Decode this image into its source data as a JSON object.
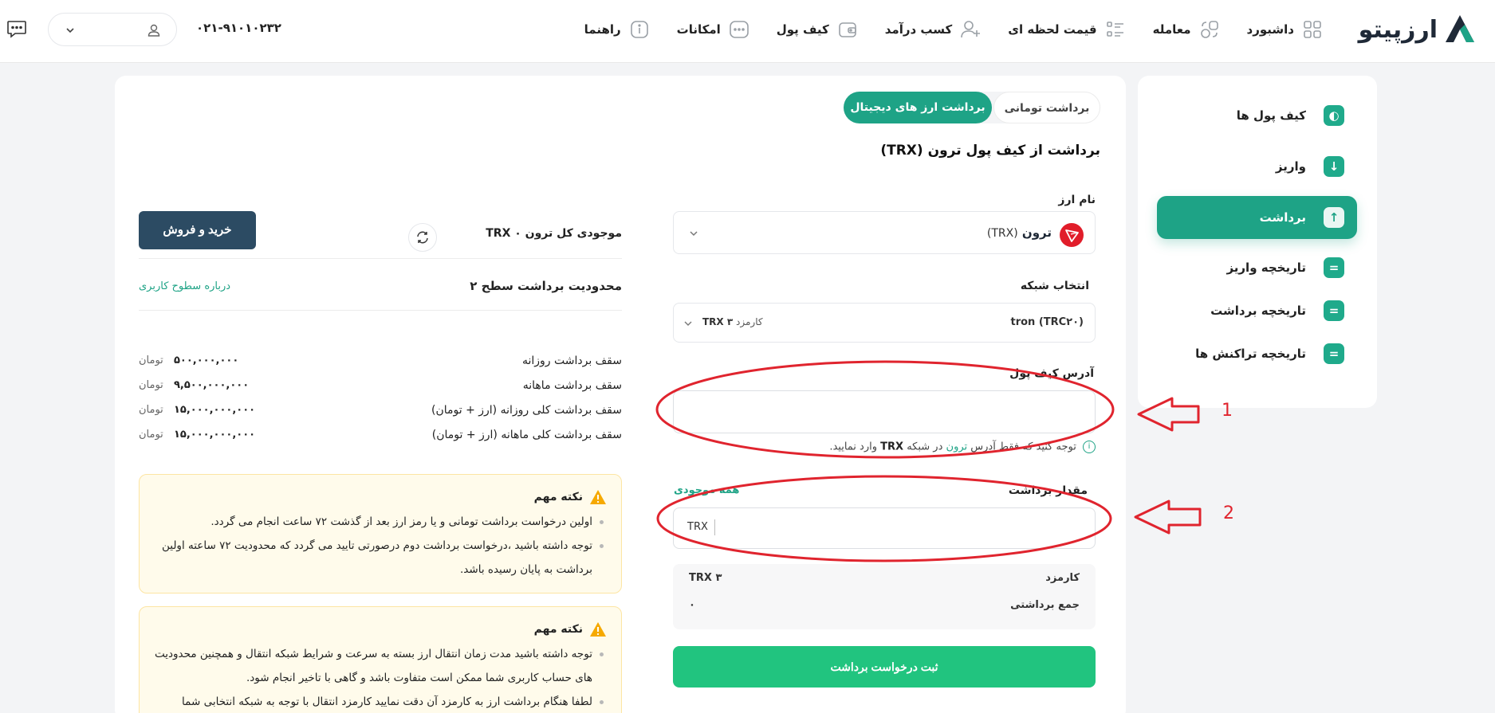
{
  "header": {
    "logo_text": "ارزپیتو",
    "nav": [
      {
        "label": "داشبورد",
        "icon": "grid-icon"
      },
      {
        "label": "معامله",
        "icon": "exchange-icon"
      },
      {
        "label": "قیمت لحظه ای",
        "icon": "price-list-icon"
      },
      {
        "label": "کسب درآمد",
        "icon": "user-plus-icon"
      },
      {
        "label": "کیف پول",
        "icon": "wallet-icon"
      },
      {
        "label": "امکانات",
        "icon": "dots-icon"
      },
      {
        "label": "راهنما",
        "icon": "info-icon"
      }
    ],
    "phone": "۰۲۱-۹۱۰۱۰۲۳۲"
  },
  "sidebar": {
    "items": [
      {
        "label": "کیف پول ها",
        "active": false
      },
      {
        "label": "واریز",
        "active": false
      },
      {
        "label": "برداشت",
        "active": true
      },
      {
        "label": "تاریخچه واریز",
        "active": false
      },
      {
        "label": "تاریخچه برداشت",
        "active": false
      },
      {
        "label": "تاریخچه تراکنش ها",
        "active": false
      }
    ]
  },
  "tabs": {
    "toman": "برداشت تومانی",
    "crypto": "برداشت ارز های دیجیتال"
  },
  "form": {
    "title": "برداشت از کیف پول ترون (TRX)",
    "currency_label": "نام ارز",
    "currency_name": "ترون",
    "currency_symbol": "(TRX)",
    "network_label": "انتخاب شبکه",
    "network_value": "tron (TRC۲۰)",
    "network_fee_label": "کارمزد",
    "network_fee_value": "۳ TRX",
    "address_label": "آدرس کیف پول",
    "address_value": "",
    "address_note_pre": "توجه کنید که فقط آدرس",
    "address_note_coin": "ترون",
    "address_note_mid": "در شبکه",
    "address_note_net": "TRX",
    "address_note_post": "وارد نمایید.",
    "amount_label": "مقدار برداشت",
    "all_balance": "همه موجودی",
    "amount_value": "",
    "amount_unit": "TRX",
    "fee_label": "کارمزد",
    "fee_value": "۳ TRX",
    "total_label": "جمع برداشتی",
    "total_value": "۰",
    "submit": "ثبت درخواست برداشت"
  },
  "balance": {
    "label": "موجودی کل ترون",
    "value": "۰",
    "unit": "TRX",
    "buy_sell": "خرید و فروش"
  },
  "limits": {
    "title": "محدودیت برداشت سطح ۲",
    "about_link": "درباره سطوح کاربری",
    "rows": [
      {
        "label": "سقف برداشت روزانه",
        "value": "۵۰۰,۰۰۰,۰۰۰",
        "unit": "تومان"
      },
      {
        "label": "سقف برداشت ماهانه",
        "value": "۹,۵۰۰,۰۰۰,۰۰۰",
        "unit": "تومان"
      },
      {
        "label": "سقف برداشت کلی روزانه (ارز + تومان)",
        "value": "۱۵,۰۰۰,۰۰۰,۰۰۰",
        "unit": "تومان"
      },
      {
        "label": "سقف برداشت کلی ماهانه (ارز + تومان)",
        "value": "۱۵,۰۰۰,۰۰۰,۰۰۰",
        "unit": "تومان"
      }
    ]
  },
  "notes": [
    {
      "title": "نکته مهم",
      "items": [
        "اولین درخواست برداشت تومانی و یا رمز ارز بعد از گذشت ۷۲ ساعت انجام می گردد.",
        "توجه داشته باشید ،درخواست برداشت دوم درصورتی تایید می گردد که محدودیت ۷۲ ساعته اولین برداشت به پایان رسیده باشد."
      ]
    },
    {
      "title": "نکته مهم",
      "items": [
        "توجه داشته باشید مدت زمان انتقال ارز بسته به سرعت و شرایط شبکه انتقال و همچنین محدودیت های حساب کاربری شما ممکن است متفاوت باشد و گاهی با تاخیر انجام شود.",
        "لطفا هنگام برداشت ارز به کارمزد آن دقت نمایید کارمزد انتقال با توجه به شبکه انتخابی شما"
      ]
    }
  ],
  "annotations": {
    "marker_1": "1",
    "marker_2": "2",
    "color": "#e0242e"
  },
  "colors": {
    "brand": "#1ea386",
    "submit": "#21c47f",
    "buy_button": "#2c4b63"
  }
}
